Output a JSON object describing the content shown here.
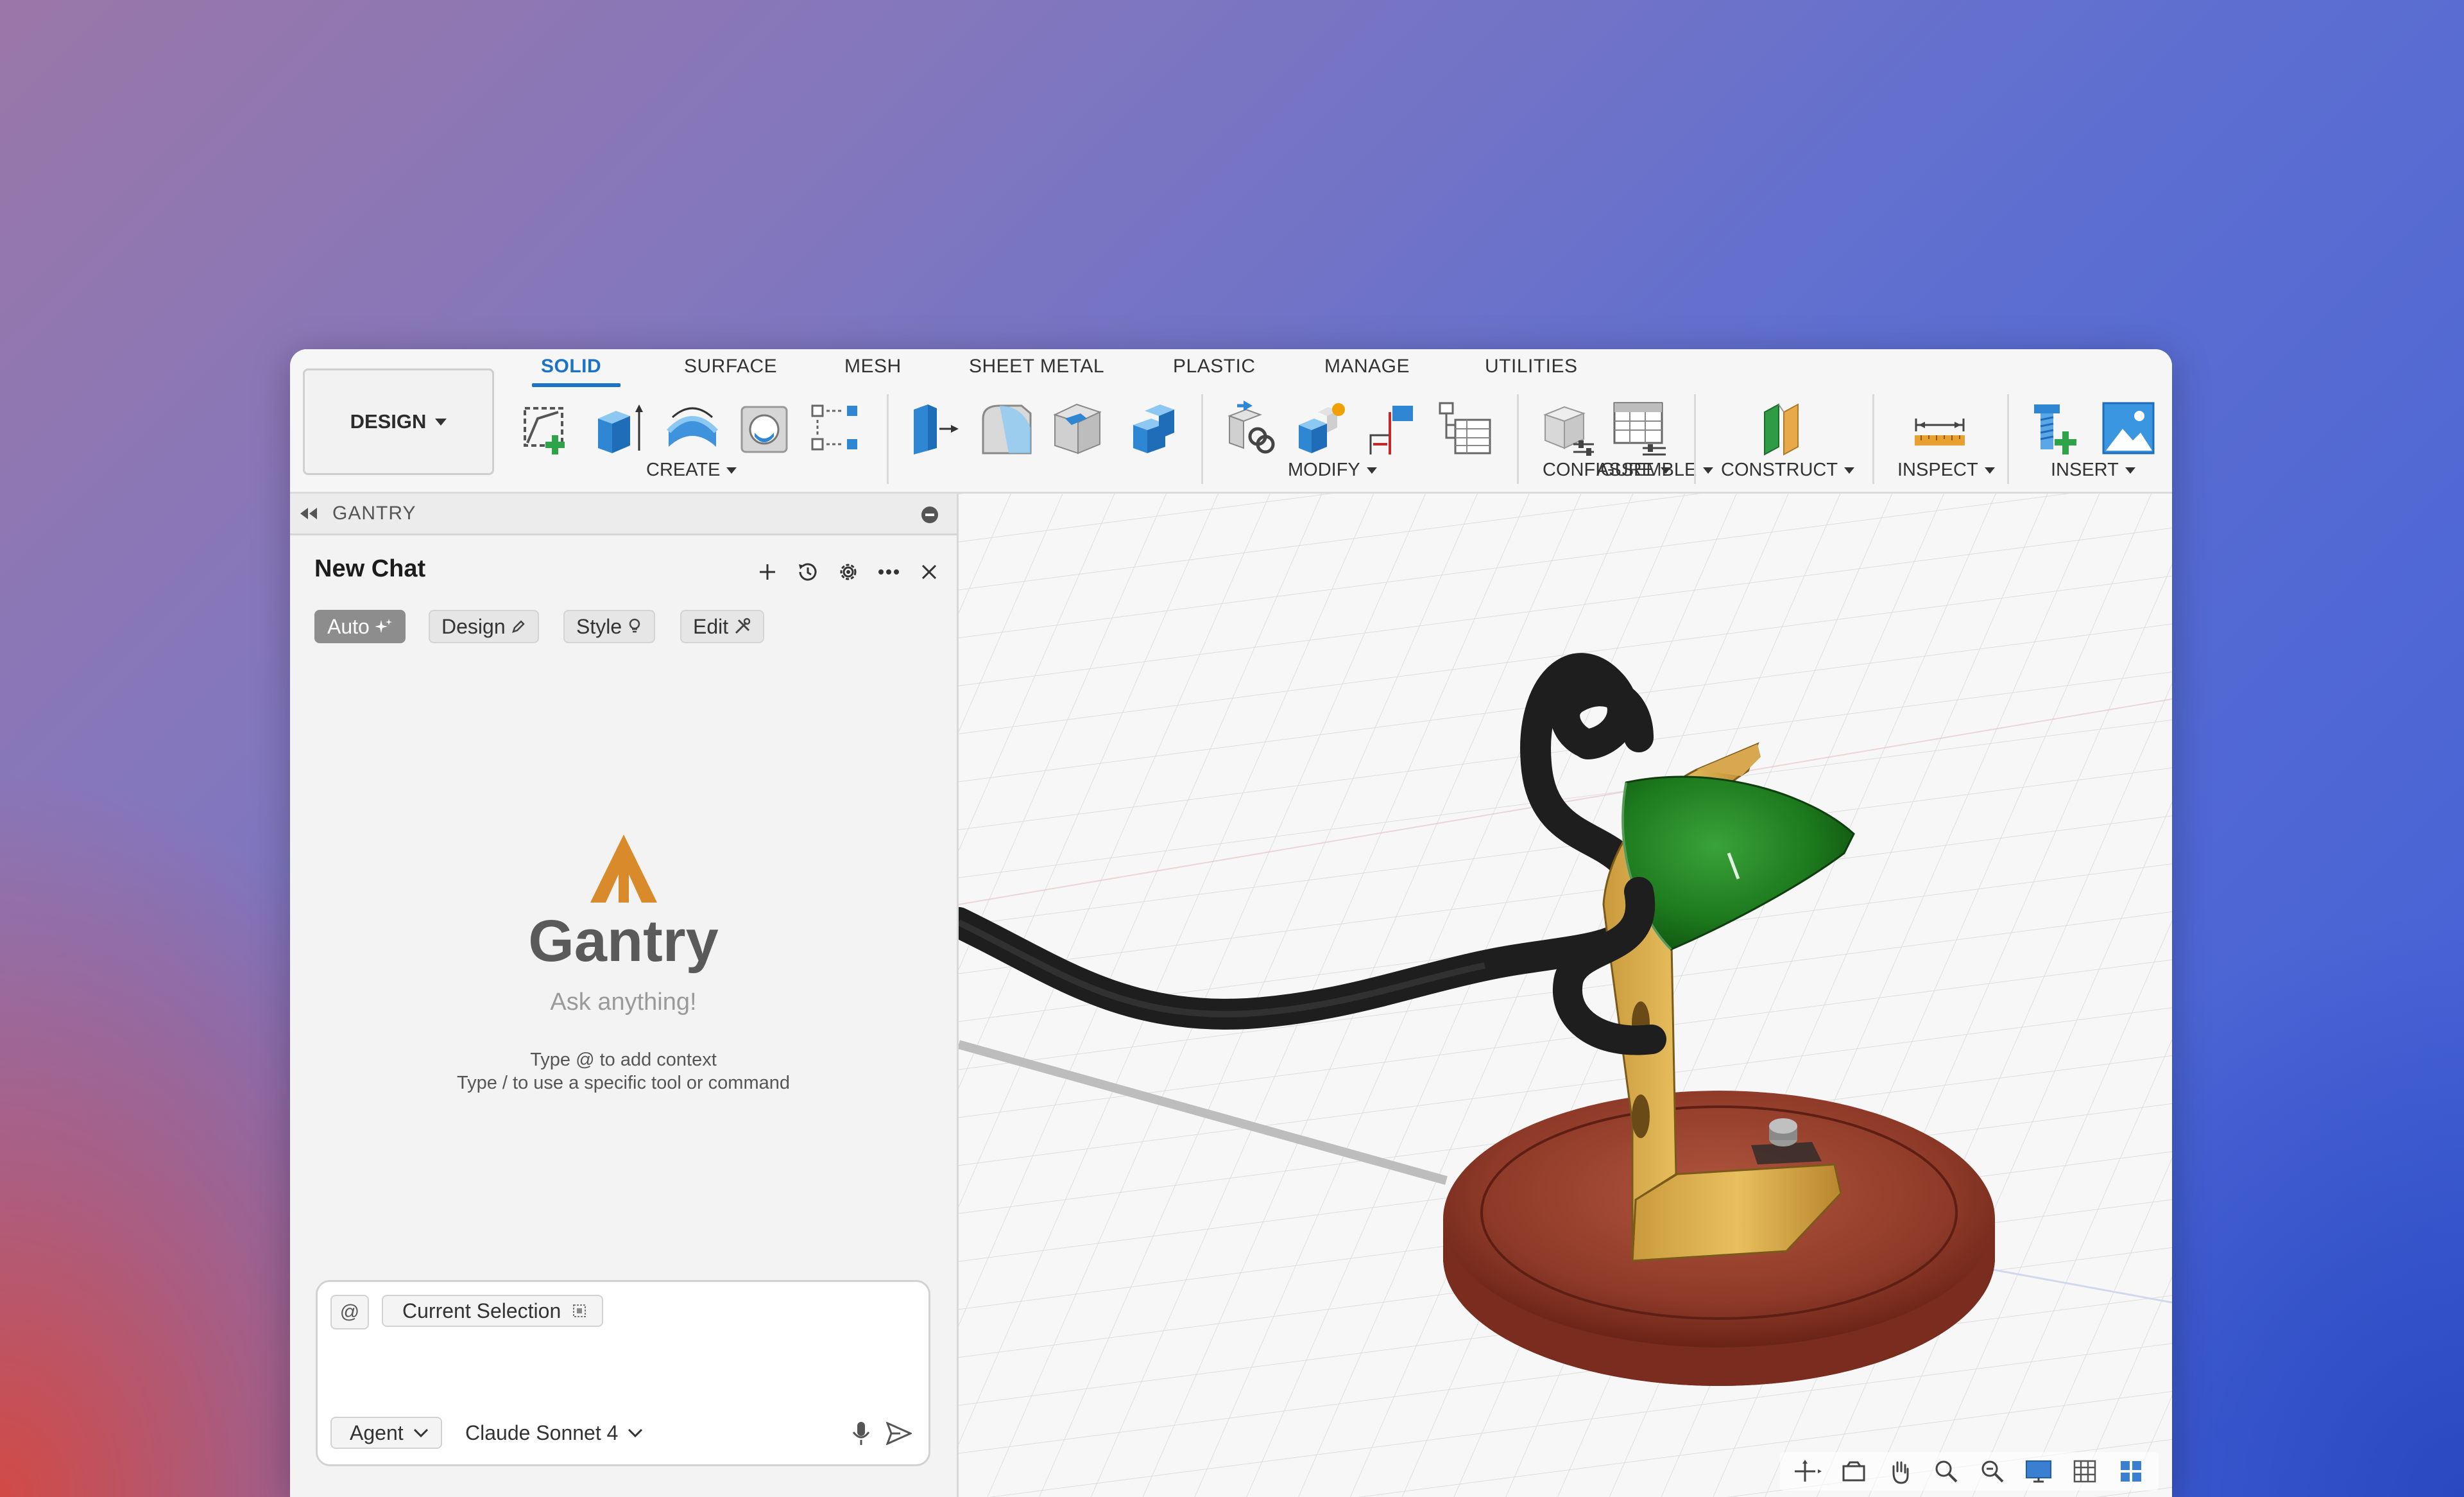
{
  "toolbar": {
    "workspace": "DESIGN",
    "tabs": [
      "SOLID",
      "SURFACE",
      "MESH",
      "SHEET METAL",
      "PLASTIC",
      "MANAGE",
      "UTILITIES"
    ],
    "groups": [
      "CREATE",
      "MODIFY",
      "ASSEMBLE",
      "CONFIGURE",
      "CONSTRUCT",
      "INSPECT",
      "INSERT"
    ],
    "accent": "#1a73c8"
  },
  "panel": {
    "title": "GANTRY",
    "chat_title": "New Chat",
    "modes": [
      "Auto",
      "Design",
      "Style",
      "Edit"
    ],
    "logo_text": "Gantry",
    "tagline": "Ask anything!",
    "hint_1": "Type @ to add context",
    "hint_2": "Type / to use a specific tool or command",
    "at_label": "@",
    "selection_chip": "Current Selection",
    "agent_label": "Agent",
    "model_label": "Claude Sonnet 4",
    "logo_color": "#d98a2b"
  },
  "viewport": {
    "model_icons": [
      "lamp-model",
      "power-cord",
      "green-lamp-shade",
      "brass-bracket",
      "wooden-base"
    ],
    "nav_icons": [
      "orbit-icon",
      "look-at-icon",
      "pan-icon",
      "zoom-icon",
      "fit-icon",
      "display-settings-icon",
      "grid-settings-icon",
      "viewports-icon"
    ]
  }
}
